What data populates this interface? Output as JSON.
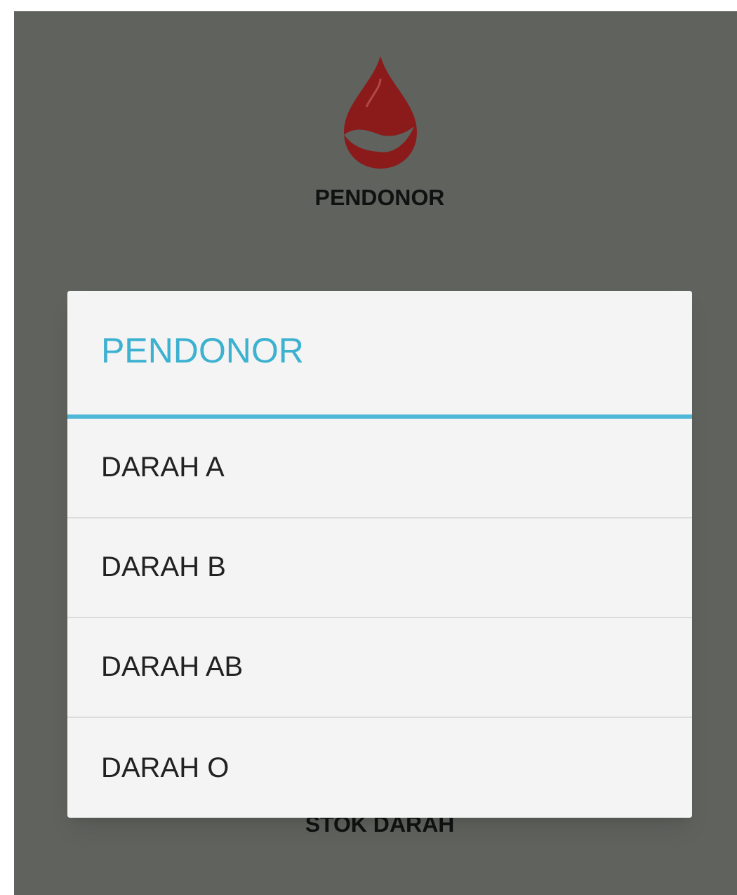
{
  "background": {
    "top_label": "PENDONOR",
    "bottom_label": "STOK DARAH"
  },
  "dialog": {
    "title": "PENDONOR",
    "items": [
      {
        "label": "DARAH A"
      },
      {
        "label": "DARAH B"
      },
      {
        "label": "DARAH AB"
      },
      {
        "label": "DARAH O"
      }
    ]
  }
}
